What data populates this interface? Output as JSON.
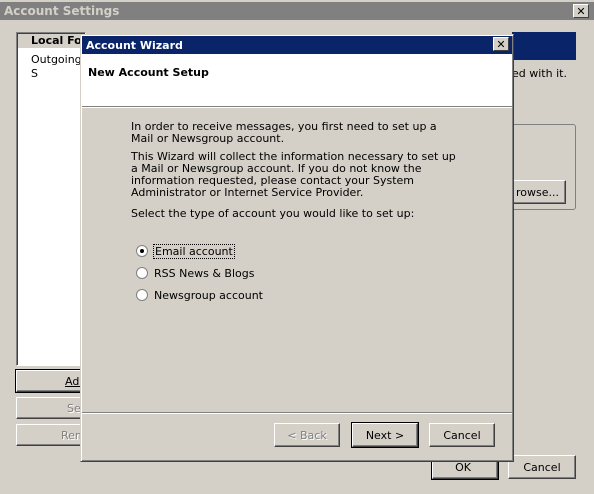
{
  "parent": {
    "title": "Account Settings",
    "close_glyph": "✕",
    "tree_items": [
      "Local Fol",
      "Outgoing S"
    ],
    "hint_text": "ed with it.",
    "browse_label": "rowse...",
    "side_buttons": [
      "Add",
      "Se",
      "Rem"
    ],
    "ok_label": "OK",
    "cancel_label": "Cancel"
  },
  "wizard": {
    "title": "Account Wizard",
    "close_glyph": "✕",
    "header": "New Account Setup",
    "para1": "In order to receive messages, you first need to set up a Mail or Newsgroup account.",
    "para2": "This Wizard will collect the information necessary to set up a Mail or Newsgroup account. If you do not know the information requested, please contact your System Administrator or Internet Service Provider.",
    "para3": "Select the type of account you would like to set up:",
    "options": [
      {
        "label": "Email account",
        "checked": true
      },
      {
        "label": "RSS News & Blogs",
        "checked": false
      },
      {
        "label": "Newsgroup account",
        "checked": false
      }
    ],
    "back_label": "< Back",
    "next_label": "Next >",
    "cancel_label": "Cancel"
  },
  "colors": {
    "inactive_title": "#808080",
    "active_title": "#0a246a",
    "face": "#d4d0c8"
  }
}
